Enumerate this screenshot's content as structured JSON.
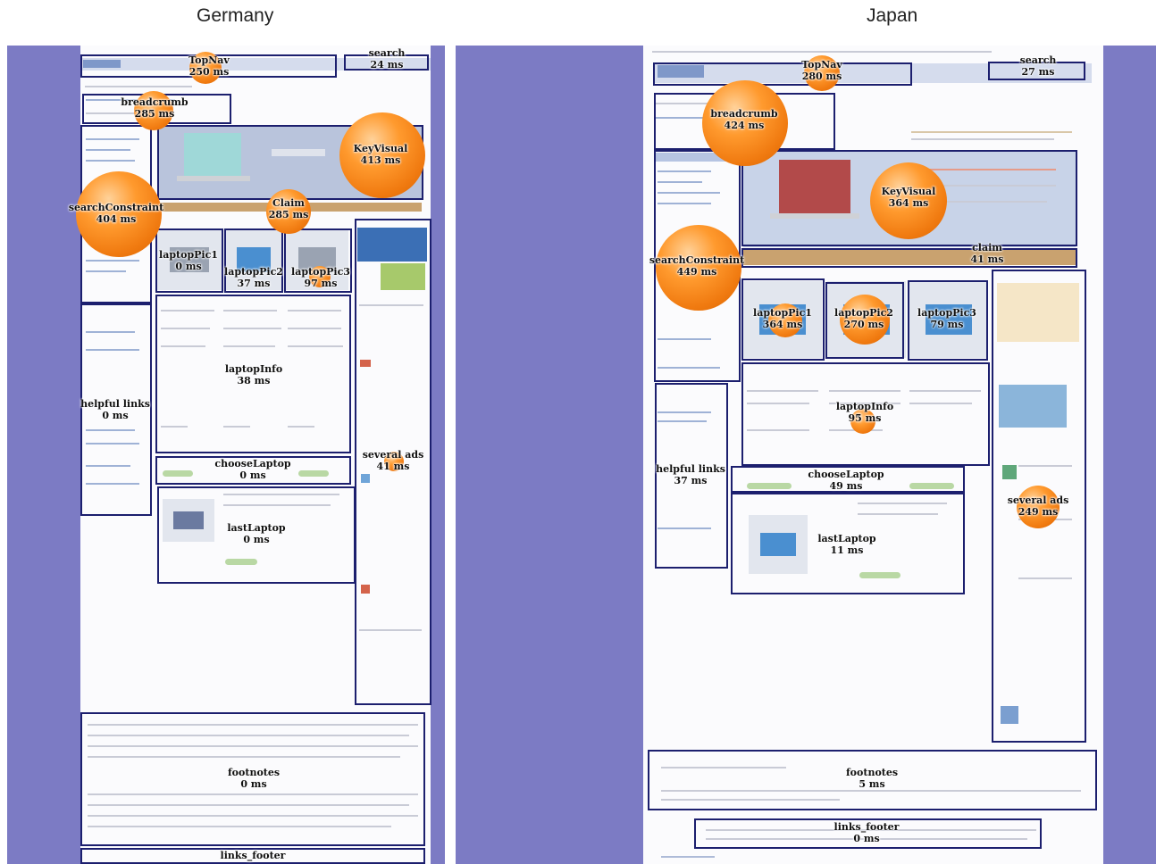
{
  "columns": {
    "left_title": "Germany",
    "right_title": "Japan"
  },
  "colors": {
    "panel_background": "#7c7bc4",
    "region_border": "#1c1f6e",
    "bubble_orange": "#f07a10"
  },
  "germany": {
    "topnav": {
      "name": "TopNav",
      "time": "250 ms"
    },
    "search": {
      "name": "search",
      "time": "24 ms"
    },
    "breadcrumb": {
      "name": "breadcrumb",
      "time": "285 ms"
    },
    "keyvisual": {
      "name": "KeyVisual",
      "time": "413 ms"
    },
    "claim": {
      "name": "Claim",
      "time": "285 ms"
    },
    "searchconstraint": {
      "name": "searchConstraint",
      "time": "404 ms"
    },
    "laptoppic1": {
      "name": "laptopPic1",
      "time": "0 ms"
    },
    "laptoppic2": {
      "name": "laptopPic2",
      "time": "37 ms"
    },
    "laptoppic3": {
      "name": "laptopPic3",
      "time": "97 ms"
    },
    "laptopinfo": {
      "name": "laptopInfo",
      "time": "38 ms"
    },
    "helpfullinks": {
      "name": "helpful links",
      "time": "0 ms"
    },
    "severalads": {
      "name": "several ads",
      "time": "41 ms"
    },
    "chooselaptop": {
      "name": "chooseLaptop",
      "time": "0 ms"
    },
    "lastlaptop": {
      "name": "lastLaptop",
      "time": "0 ms"
    },
    "footnotes": {
      "name": "footnotes",
      "time": "0 ms"
    },
    "links_footer": {
      "name": "links_footer"
    }
  },
  "japan": {
    "topnav": {
      "name": "TopNav",
      "time": "280 ms"
    },
    "search": {
      "name": "search",
      "time": "27 ms"
    },
    "breadcrumb": {
      "name": "breadcrumb",
      "time": "424 ms"
    },
    "keyvisual": {
      "name": "KeyVisual",
      "time": "364 ms"
    },
    "claim": {
      "name": "claim",
      "time": "41 ms"
    },
    "searchconstraint": {
      "name": "searchConstraint",
      "time": "449 ms"
    },
    "laptoppic1": {
      "name": "laptopPic1",
      "time": "364 ms"
    },
    "laptoppic2": {
      "name": "laptopPic2",
      "time": "270 ms"
    },
    "laptoppic3": {
      "name": "laptopPic3",
      "time": "79 ms"
    },
    "laptopinfo": {
      "name": "laptopInfo",
      "time": "95 ms"
    },
    "helpfullinks": {
      "name": "helpful links",
      "time": "37 ms"
    },
    "severalads": {
      "name": "several ads",
      "time": "249 ms"
    },
    "chooselaptop": {
      "name": "chooseLaptop",
      "time": "49 ms"
    },
    "lastlaptop": {
      "name": "lastLaptop",
      "time": "11 ms"
    },
    "footnotes": {
      "name": "footnotes",
      "time": "5 ms"
    },
    "links_footer": {
      "name": "links_footer",
      "time": "0 ms"
    }
  }
}
